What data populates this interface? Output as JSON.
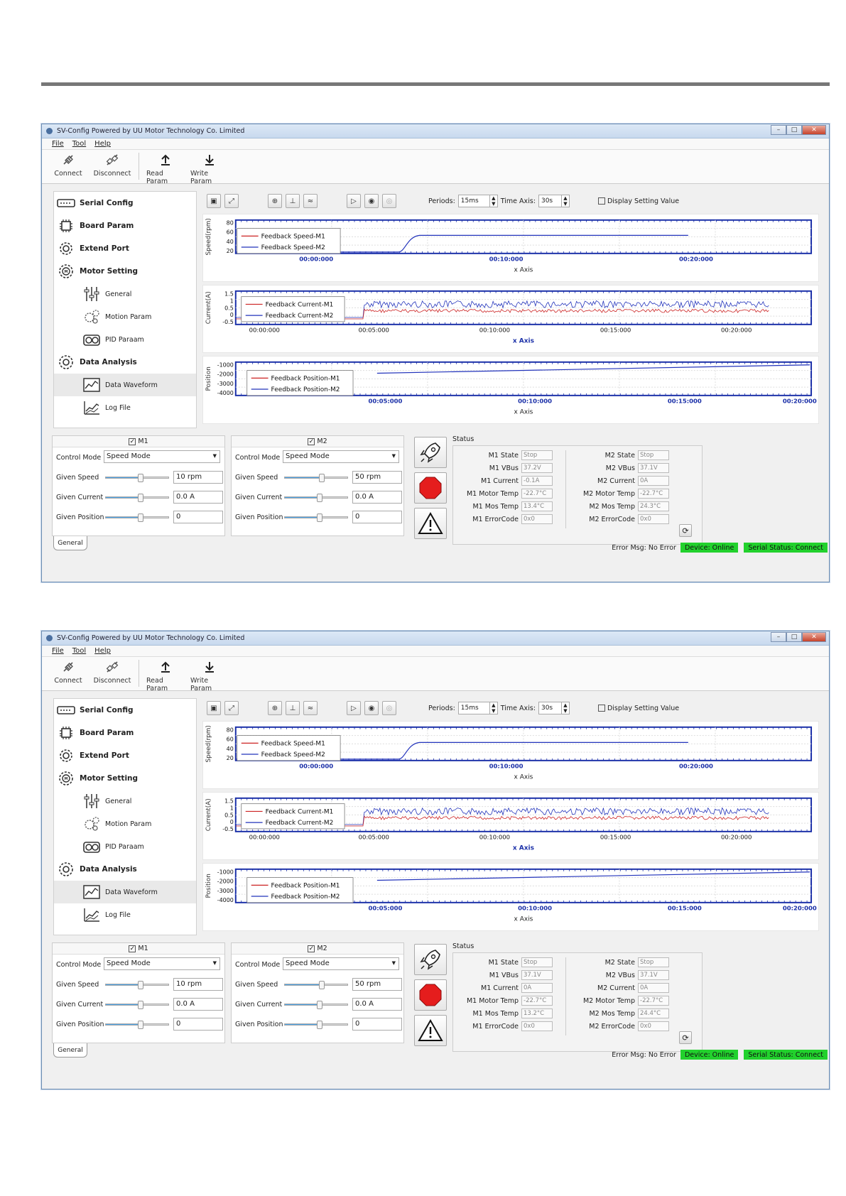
{
  "app_title": "SV-Config Powered by UU Motor Technology Co. Limited",
  "window_buttons": {
    "minimize": "–",
    "maximize": "□",
    "close": "✕"
  },
  "menu": [
    "File",
    "Tool",
    "Help"
  ],
  "toolbar": {
    "connect": "Connect",
    "disconnect": "Disconnect",
    "read_param": "Read Param",
    "write_param": "Write Param"
  },
  "nav": {
    "serial_config": "Serial Config",
    "board_param": "Board Param",
    "extend_port": "Extend Port",
    "motor_setting": "Motor Setting",
    "general": "General",
    "motion_param": "Motion Param",
    "pid_param": "PID Paraam",
    "data_analysis": "Data Analysis",
    "data_waveform": "Data Waveform",
    "log_file": "Log File"
  },
  "plot_toolbar": {
    "periods_label": "Periods:",
    "periods_value": "15ms",
    "time_axis_label": "Time Axis:",
    "time_axis_value": "30s",
    "display_setting_label": "Display Setting Value"
  },
  "charts": {
    "speed": {
      "ylabel": "Speed(rpm)",
      "xlabel": "x Axis",
      "yticks": [
        "80",
        "60",
        "40",
        "20"
      ],
      "xticks": [
        "00:00:000",
        "00:10:000",
        "00:20:000"
      ],
      "legend": [
        "Feedback Speed-M1",
        "Feedback Speed-M2"
      ]
    },
    "current": {
      "ylabel": "Current(A)",
      "xlabel": "x Axis",
      "yticks": [
        "1.5",
        "1",
        "0.5",
        "0",
        "-0.5"
      ],
      "xticks": [
        "00:00:000",
        "00:05:000",
        "00:10:000",
        "00:15:000",
        "00:20:000"
      ],
      "legend": [
        "Feedback Current-M1",
        "Feedback Current-M2"
      ]
    },
    "position": {
      "ylabel": "Position",
      "xlabel": "x Axis",
      "yticks": [
        "-1000",
        "-2000",
        "-3000",
        "-4000"
      ],
      "xticks": [
        "00:05:000",
        "00:10:000",
        "00:15:000",
        "00:20:000"
      ],
      "legend": [
        "Feedback Position-M1",
        "Feedback Position-M2"
      ]
    }
  },
  "motors": {
    "m1": {
      "title": "M1",
      "control_mode_label": "Control Mode",
      "control_mode": "Speed Mode",
      "given_speed_label": "Given Speed",
      "given_speed": "10 rpm",
      "given_current_label": "Given Current",
      "given_current": "0.0 A",
      "given_position_label": "Given Position",
      "given_position": "0"
    },
    "m2": {
      "title": "M2",
      "control_mode_label": "Control Mode",
      "control_mode": "Speed Mode",
      "given_speed_label": "Given Speed",
      "given_speed": "50 rpm",
      "given_current_label": "Given Current",
      "given_current": "0.0 A",
      "given_position_label": "Given Position",
      "given_position": "0"
    }
  },
  "bottom_tab": "General",
  "status_title": "Status",
  "status_labels": {
    "m1": [
      "M1 State",
      "M1 VBus",
      "M1 Current",
      "M1 Motor Temp",
      "M1 Mos Temp",
      "M1 ErrorCode"
    ],
    "m2": [
      "M2 State",
      "M2 VBus",
      "M2 Current",
      "M2 Motor Temp",
      "M2 Mos Temp",
      "M2 ErrorCode"
    ]
  },
  "status_values_1": {
    "m1": [
      "Stop",
      "37.2V",
      "-0.1A",
      "-22.7°C",
      "13.4°C",
      "0x0"
    ],
    "m2": [
      "Stop",
      "37.1V",
      "0A",
      "-22.7°C",
      "24.3°C",
      "0x0"
    ]
  },
  "status_values_2": {
    "m1": [
      "Stop",
      "37.1V",
      "0A",
      "-22.7°C",
      "13.2°C",
      "0x0"
    ],
    "m2": [
      "Stop",
      "37.1V",
      "0A",
      "-22.7°C",
      "24.4°C",
      "0x0"
    ]
  },
  "statusbar": {
    "error_msg": "Error Msg: No Error",
    "device": "Device: Online",
    "serial": "Serial Status: Connect"
  },
  "colors": {
    "m1": "#cc2222",
    "m2": "#2233bb",
    "status_green": "#22d12d"
  }
}
